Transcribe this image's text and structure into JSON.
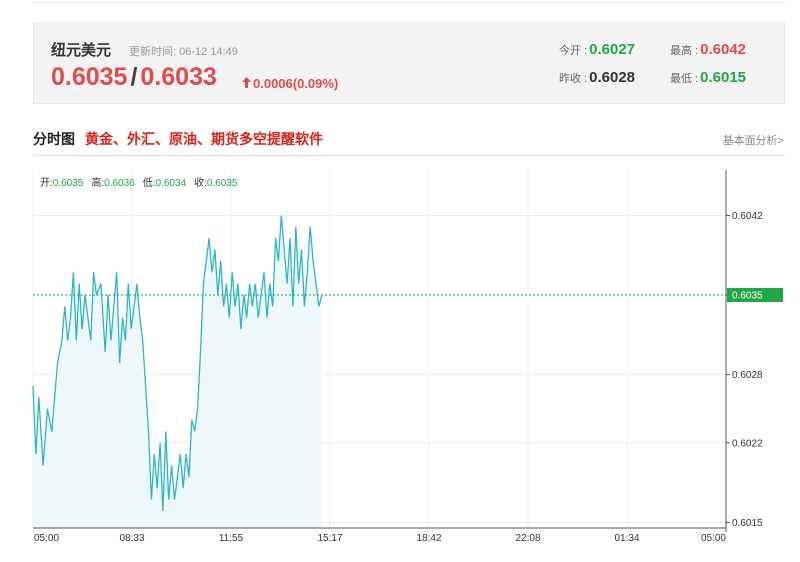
{
  "quote": {
    "pair_name": "纽元美元",
    "update_label": "更新时间: 06-12 14:49",
    "bid": "0.6035",
    "separator": "/",
    "ask": "0.6033",
    "change": "0.0006(0.09%)",
    "open_label": "今开 :",
    "open_value": "0.6027",
    "high_label": "最高 :",
    "high_value": "0.6042",
    "prev_close_label": "昨收 :",
    "prev_close_value": "0.6028",
    "low_label": "最低 :",
    "low_value": "0.6015"
  },
  "section": {
    "title": "分时图",
    "promo_text": "黄金、外汇、原油、期货多空提醒软件",
    "analysis_link": "基本面分析>"
  },
  "colors": {
    "line": "#2cb5c9",
    "area": "#eef8fb",
    "up": "#e24b4b",
    "down": "#22a547",
    "current_line": "#22a547",
    "grid": "#ececec"
  },
  "chart_data": {
    "type": "area",
    "ohlc": [
      {
        "label": "开:",
        "value": "0.6035"
      },
      {
        "label": "高:",
        "value": "0.6036"
      },
      {
        "label": "低:",
        "value": "0.6034"
      },
      {
        "label": "收:",
        "value": "0.6035"
      }
    ],
    "x_ticks": [
      "05:00",
      "08:33",
      "11:55",
      "15:17",
      "18:42",
      "22:08",
      "01:34",
      "05:00"
    ],
    "y_ticks": [
      0.6042,
      0.6035,
      0.6028,
      0.6022,
      0.6015
    ],
    "y_tick_labels": [
      "0.6042",
      "0.6035",
      "0.6028",
      "0.6022",
      "0.6015"
    ],
    "current_value": 0.6035,
    "current_label": "0.6035",
    "ylim": [
      0.60145,
      0.6046
    ],
    "x_range_hours": [
      0,
      24
    ],
    "series": [
      {
        "x": [
          0,
          0.1,
          0.2,
          0.35,
          0.5,
          0.65,
          0.85,
          1.0,
          1.1,
          1.2,
          1.3,
          1.4,
          1.5,
          1.6,
          1.7,
          1.8,
          1.9,
          2.0,
          2.1,
          2.2,
          2.35,
          2.5,
          2.6,
          2.7,
          2.8,
          2.9,
          3.0,
          3.1,
          3.2,
          3.3,
          3.4,
          3.5,
          3.6,
          3.7,
          3.8,
          3.9,
          4.0,
          4.1,
          4.2,
          4.3,
          4.4,
          4.5,
          4.6,
          4.7,
          4.8,
          4.9,
          5.0,
          5.1,
          5.2,
          5.3,
          5.4,
          5.5,
          5.6,
          5.7,
          5.8,
          5.9,
          6.0,
          6.1,
          6.2,
          6.3,
          6.4,
          6.5,
          6.6,
          6.7,
          6.8,
          6.9,
          7.0,
          7.1,
          7.2,
          7.3,
          7.4,
          7.5,
          7.6,
          7.7,
          7.8,
          7.9,
          8.0,
          8.1,
          8.2,
          8.3,
          8.4,
          8.5,
          8.6,
          8.7,
          8.8,
          8.9,
          9.0,
          9.1,
          9.2,
          9.3,
          9.4,
          9.5,
          9.6,
          9.7,
          9.8,
          9.9,
          10.0
        ],
        "y": [
          0.6027,
          0.6021,
          0.6026,
          0.602,
          0.6025,
          0.6023,
          0.6029,
          0.6031,
          0.6034,
          0.6031,
          0.6033,
          0.6037,
          0.6031,
          0.6036,
          0.6032,
          0.6035,
          0.6033,
          0.6031,
          0.6037,
          0.6035,
          0.6036,
          0.603,
          0.6035,
          0.6031,
          0.6034,
          0.6037,
          0.6029,
          0.6033,
          0.6031,
          0.6036,
          0.6032,
          0.6034,
          0.6036,
          0.6033,
          0.6031,
          0.6027,
          0.6023,
          0.6017,
          0.6021,
          0.6018,
          0.6022,
          0.6016,
          0.6023,
          0.6017,
          0.602,
          0.6017,
          0.6019,
          0.6021,
          0.6018,
          0.6021,
          0.6019,
          0.6024,
          0.6023,
          0.6025,
          0.603,
          0.6036,
          0.6038,
          0.604,
          0.6037,
          0.6039,
          0.6035,
          0.6038,
          0.6034,
          0.6036,
          0.6033,
          0.6037,
          0.6034,
          0.6036,
          0.6032,
          0.6035,
          0.6033,
          0.6036,
          0.6034,
          0.6036,
          0.6033,
          0.6035,
          0.6037,
          0.6033,
          0.6036,
          0.6034,
          0.604,
          0.6038,
          0.6042,
          0.6039,
          0.6036,
          0.604,
          0.6034,
          0.6041,
          0.6036,
          0.6039,
          0.6034,
          0.6037,
          0.6041,
          0.6038,
          0.6036,
          0.6034,
          0.6035
        ]
      }
    ]
  }
}
